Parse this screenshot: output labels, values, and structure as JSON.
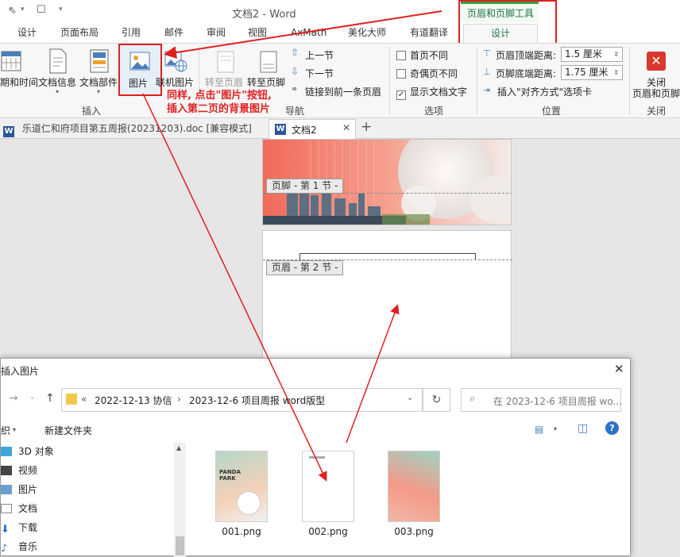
{
  "window": {
    "title": "文档2 - Word"
  },
  "context_tab": {
    "group_label": "页眉和页脚工具",
    "tab_label": "设计"
  },
  "ribbon_tabs": [
    "设计",
    "页面布局",
    "引用",
    "邮件",
    "审阅",
    "视图",
    "AxMath",
    "美化大师",
    "有道翻译"
  ],
  "ribbon": {
    "insert": {
      "datetime_label": "期和时间",
      "docinfo_label": "文档信息",
      "docparts_label": "文档部件",
      "picture_label": "图片",
      "online_picture_label": "联机图片",
      "group_label": "插入"
    },
    "nav": {
      "goto_header": "转至页眉",
      "goto_footer": "转至页脚",
      "prev_section": "上一节",
      "next_section": "下一节",
      "link_prev": "链接到前一条页眉",
      "group_label": "导航"
    },
    "options": {
      "diff_first": "首页不同",
      "diff_odd_even": "奇偶页不同",
      "show_text": "显示文档文字",
      "group_label": "选项"
    },
    "position": {
      "header_top_label": "页眉顶端距离:",
      "header_top_value": "1.5 厘米",
      "footer_bottom_label": "页脚底端距离:",
      "footer_bottom_value": "1.75 厘米",
      "insert_align_tab": "插入\"对齐方式\"选项卡",
      "group_label": "位置"
    },
    "close": {
      "line1": "关闭",
      "line2": "页眉和页脚",
      "group_label": "关闭"
    }
  },
  "annotation": {
    "line1": "同样, 点击\"图片\"按钮,",
    "line2": "插入第二页的背景图片"
  },
  "doc_tabs": [
    {
      "label": "乐道仁和府项目第五周报(20231203).doc [兼容模式]"
    },
    {
      "label": "文档2"
    }
  ],
  "pages": {
    "footer_tag": "页脚 - 第 1 节 -",
    "header_tag": "页眉 - 第 2 节 -"
  },
  "dialog": {
    "title": "插入图片",
    "path": [
      "«",
      "2022-12-13 协信",
      "›",
      "2023-12-6 项目周报 word版型"
    ],
    "search_placeholder": "在 2023-12-6 项目周报 wo...",
    "organize_label": "织",
    "new_folder_label": "新建文件夹",
    "nav_items": [
      "3D 对象",
      "视频",
      "图片",
      "文档",
      "下载",
      "音乐"
    ],
    "files": [
      "001.png",
      "002.png",
      "003.png"
    ]
  },
  "colors": {
    "accent_green": "#217346",
    "annotation_red": "#e02020",
    "word_blue": "#2b579a"
  }
}
